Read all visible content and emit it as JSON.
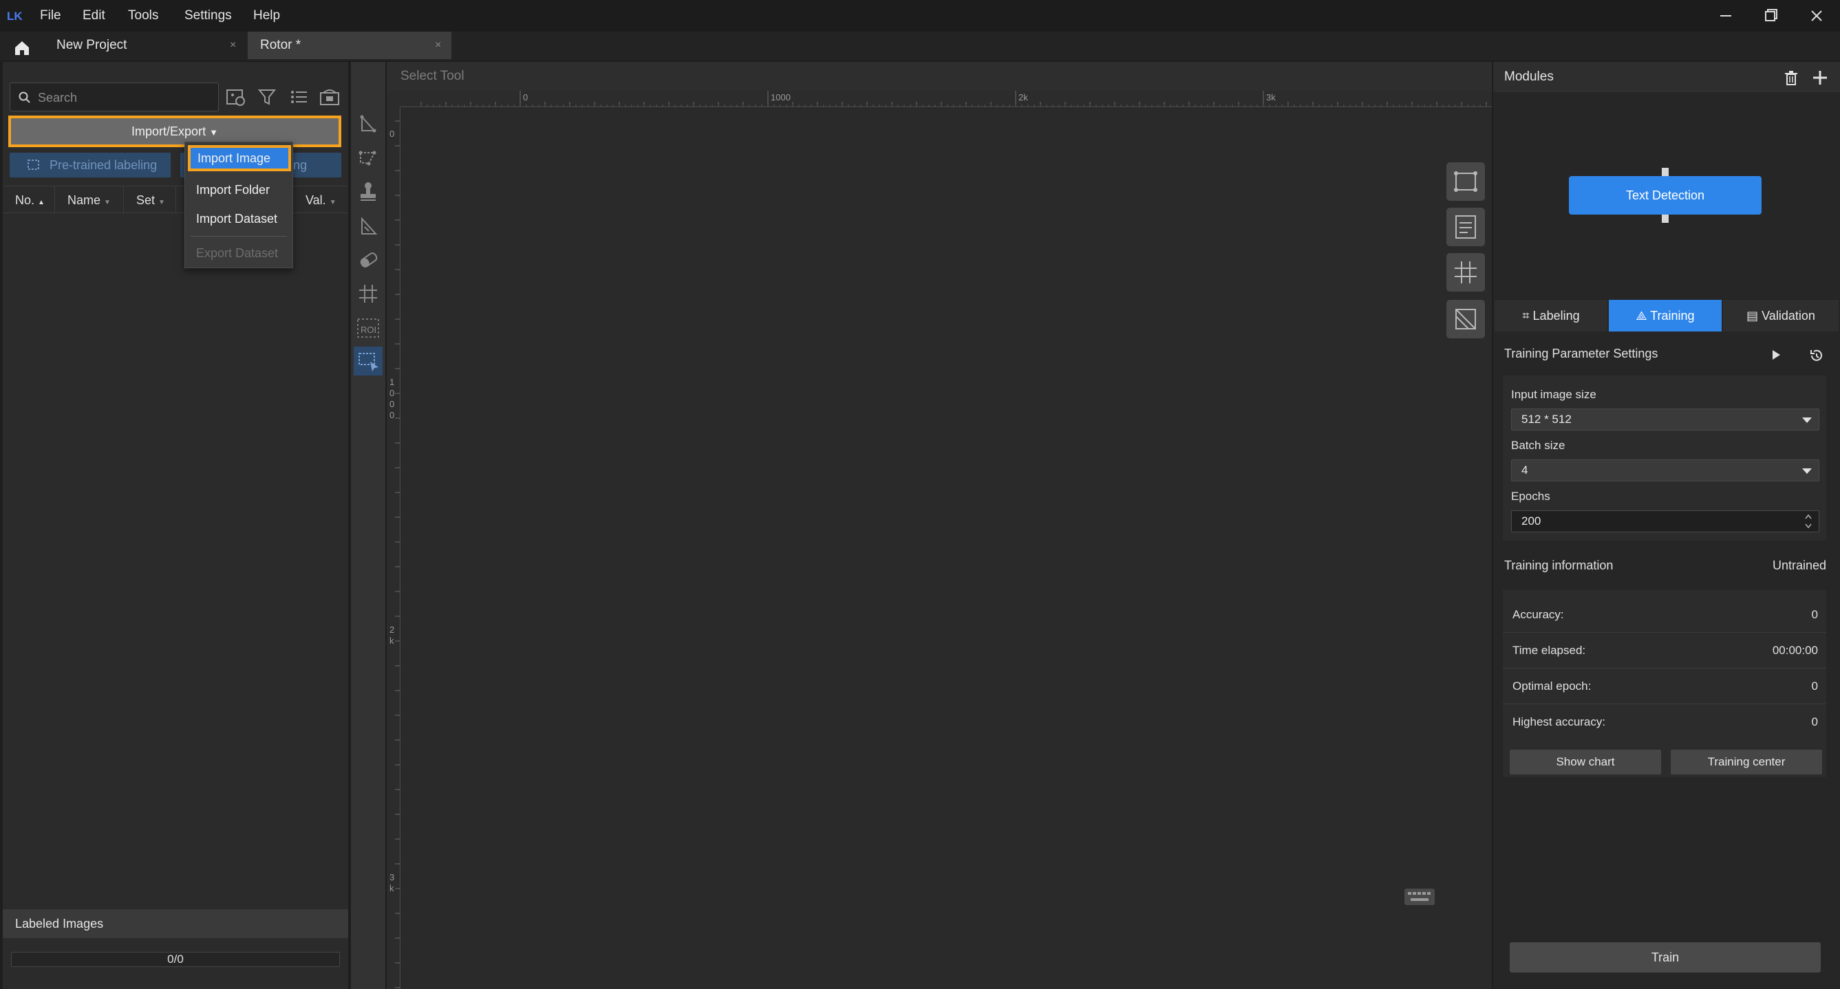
{
  "menu": {
    "items": [
      "File",
      "Edit",
      "Tools",
      "Settings",
      "Help"
    ]
  },
  "tabs": {
    "items": [
      {
        "label": "New Project"
      },
      {
        "label": "Rotor *"
      }
    ]
  },
  "left_panel": {
    "search_placeholder": "Search",
    "import_export_label": "Import/Export",
    "pretrained_label": "Pre-trained labeling",
    "hidden_label": "ing",
    "columns": [
      "No.",
      "Name",
      "Set",
      "Val."
    ],
    "dropdown": {
      "items": [
        "Import Image",
        "Import Folder",
        "Import Dataset",
        "Export Dataset"
      ]
    },
    "labeled_images_title": "Labeled Images",
    "labeled_progress": "0/0"
  },
  "canvas": {
    "tool_title": "Select Tool",
    "ruler_top_labels": [
      "0",
      "1000",
      "2k",
      "3k"
    ],
    "ruler_left_labels": [
      "0",
      "1000",
      "2k",
      "3k"
    ]
  },
  "right_panel": {
    "modules_title": "Modules",
    "module_node": "Text Detection",
    "tabs": [
      "Labeling",
      "Training",
      "Validation"
    ],
    "active_tab": "Training",
    "training_parameter_settings": "Training Parameter Settings",
    "params": {
      "input_image_size_label": "Input image size",
      "input_image_size_value": "512 * 512",
      "batch_size_label": "Batch size",
      "batch_size_value": "4",
      "epochs_label": "Epochs",
      "epochs_value": "200"
    },
    "training_information": "Training information",
    "training_status": "Untrained",
    "info_rows": [
      {
        "label": "Accuracy:",
        "value": "0"
      },
      {
        "label": "Time elapsed:",
        "value": "00:00:00"
      },
      {
        "label": "Optimal epoch:",
        "value": "0"
      },
      {
        "label": "Highest accuracy:",
        "value": "0"
      }
    ],
    "show_chart_label": "Show chart",
    "training_center_label": "Training center",
    "train_label": "Train"
  },
  "colors": {
    "accent_blue": "#2f86ea",
    "highlight_orange": "#f5a21e",
    "background": "#1e1e1e"
  }
}
